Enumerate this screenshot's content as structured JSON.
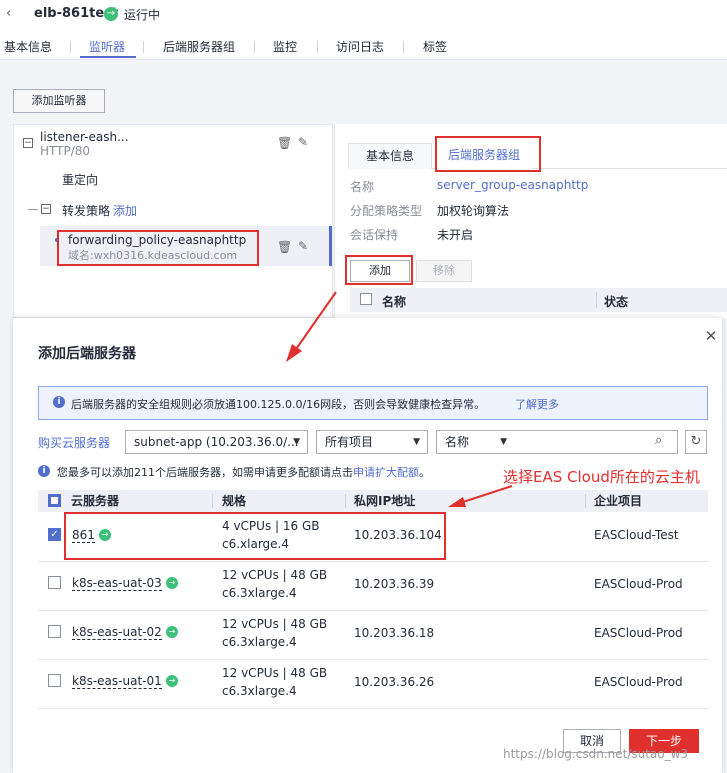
{
  "header": {
    "instance_name": "elb-861test",
    "status": "运行中"
  },
  "nav_tabs": [
    "基本信息",
    "监听器",
    "后端服务器组",
    "监控",
    "访问日志",
    "标签"
  ],
  "listener_page": {
    "add_listener": "添加监听器",
    "listener_name": "listener-eash...",
    "listener_protocol": "HTTP/80",
    "redirect": "重定向",
    "forwarding_policy": "转发策略",
    "forwarding_add": "添加",
    "policy_name": "forwarding_policy-easnaphttp",
    "policy_domain": "域名:wxh0316.kdeascloud.com"
  },
  "detail_panel": {
    "tab_basic": "基本信息",
    "tab_group": "后端服务器组",
    "name_key": "名称",
    "name_val": "server_group-easnaphttp",
    "algo_key": "分配策略类型",
    "algo_val": "加权轮询算法",
    "session_key": "会话保持",
    "session_val": "未开启",
    "add_btn": "添加",
    "remove_btn": "移除",
    "col_name": "名称",
    "col_status": "状态"
  },
  "modal": {
    "title": "添加后端服务器",
    "info_text": "后端服务器的安全组规则必须放通100.125.0.0/16网段，否则会导致健康检查异常。",
    "info_link": "了解更多",
    "buy_link": "购买云服务器",
    "subnet_select": "subnet-app (10.203.36.0/...",
    "project_select": "所有项目",
    "field_select": "名称",
    "search_placeholder": "",
    "quota_text": "您最多可以添加211个后端服务器，如需申请更多配额请点击",
    "quota_link": "申请扩大配额",
    "quota_end": "。",
    "annotation": "选择EAS Cloud所在的云主机",
    "columns": [
      "云服务器",
      "规格",
      "私网IP地址",
      "企业项目"
    ],
    "rows": [
      {
        "name": "861",
        "spec1": "4 vCPUs | 16 GB",
        "spec2": "c6.xlarge.4",
        "ip": "10.203.36.104",
        "project": "EASCloud-Test",
        "checked": true
      },
      {
        "name": "k8s-eas-uat-03",
        "spec1": "12 vCPUs | 48 GB",
        "spec2": "c6.3xlarge.4",
        "ip": "10.203.36.39",
        "project": "EASCloud-Prod",
        "checked": false
      },
      {
        "name": "k8s-eas-uat-02",
        "spec1": "12 vCPUs | 48 GB",
        "spec2": "c6.3xlarge.4",
        "ip": "10.203.36.18",
        "project": "EASCloud-Prod",
        "checked": false
      },
      {
        "name": "k8s-eas-uat-01",
        "spec1": "12 vCPUs | 48 GB",
        "spec2": "c6.3xlarge.4",
        "ip": "10.203.36.26",
        "project": "EASCloud-Prod",
        "checked": false
      }
    ],
    "cancel": "取消",
    "next": "下一步"
  },
  "watermark": "https://blog.csdn.net/sutao_w3",
  "colors": {
    "accent": "#526ecc",
    "danger": "#e0302d",
    "success": "#3dc07a"
  }
}
